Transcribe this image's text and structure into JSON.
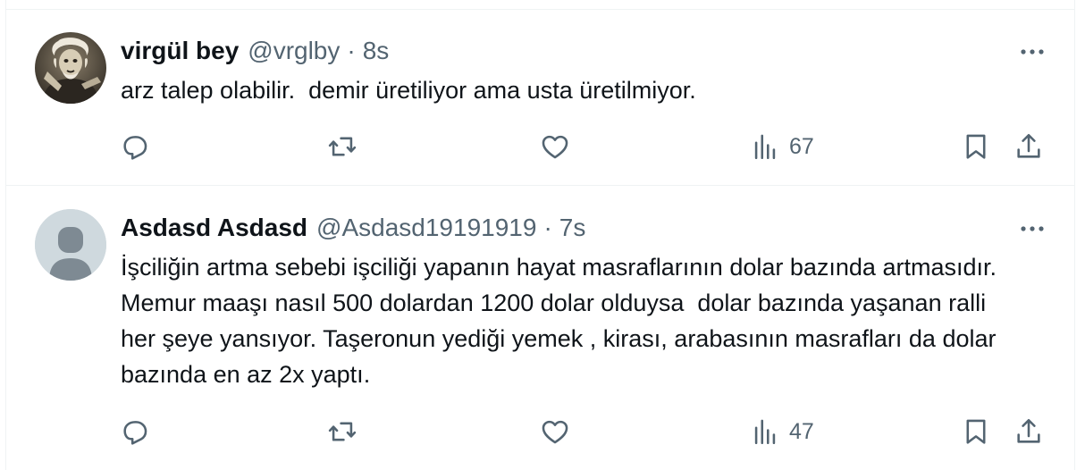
{
  "tweets": [
    {
      "name": "virgül bey",
      "handle": "@vrglby",
      "separator": "·",
      "time": "8s",
      "text": "arz talep olabilir.  demir üretiliyor ama usta üretilmiyor.",
      "avatar_icon": "vintage-portrait-avatar",
      "views": "67"
    },
    {
      "name": "Asdasd Asdasd",
      "handle": "@Asdasd19191919",
      "separator": "·",
      "time": "7s",
      "text": "İşciliğin artma sebebi işciliği yapanın hayat masraflarının dolar bazında artmasıdır.  Memur maaşı nasıl 500 dolardan 1200 dolar olduysa  dolar bazında yaşanan ralli her şeye yansıyor. Taşeronun yediği yemek , kirası, arabasının masrafları da dolar bazında en az 2x yaptı.",
      "avatar_icon": "default-user-avatar",
      "views": "47"
    }
  ],
  "icons": {
    "more": "more-horizontal-icon",
    "reply": "reply-icon",
    "retweet": "retweet-icon",
    "like": "heart-icon",
    "views": "views-chart-icon",
    "bookmark": "bookmark-icon",
    "share": "share-icon"
  },
  "colors": {
    "text_primary": "#0f1419",
    "text_secondary": "#536471",
    "divider": "#eff3f4",
    "default_avatar_bg": "#cfd9de",
    "default_avatar_fg": "#7e8a93"
  }
}
